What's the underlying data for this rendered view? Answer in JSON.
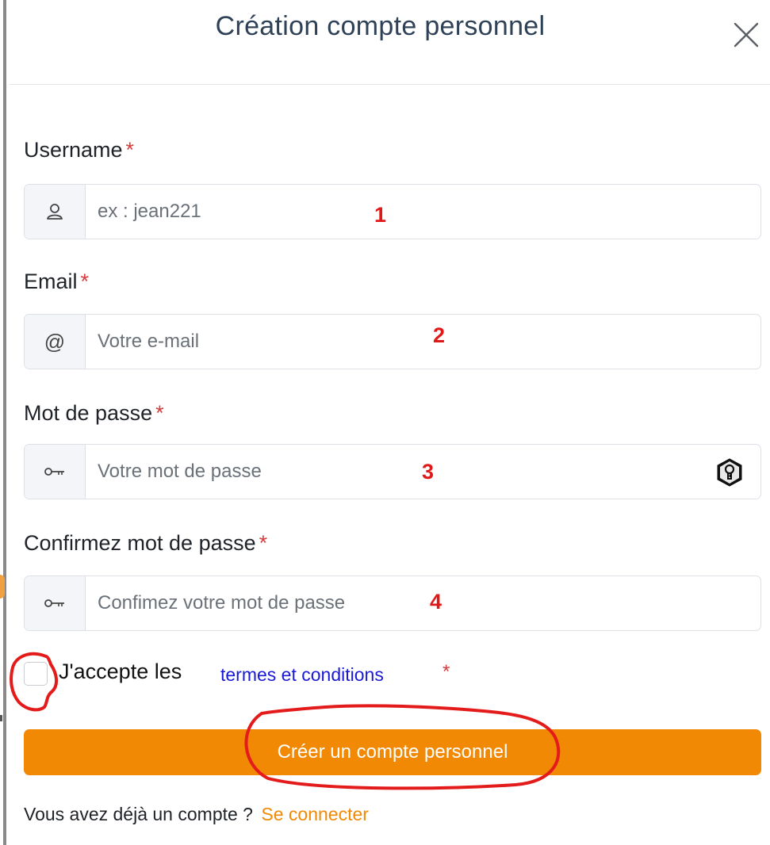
{
  "modal": {
    "title": "Création compte personnel"
  },
  "form": {
    "username": {
      "label": "Username",
      "required_mark": "*",
      "placeholder": "ex : jean221",
      "icon": "user-icon",
      "annotation": "1"
    },
    "email": {
      "label": "Email",
      "required_mark": "*",
      "placeholder": "Votre e-mail",
      "icon_text": "@",
      "annotation": "2"
    },
    "password": {
      "label": "Mot de passe",
      "required_mark": "*",
      "placeholder": "Votre mot de passe",
      "icon": "key-icon",
      "toggle_icon": "keyhole-shield-icon",
      "annotation": "3"
    },
    "confirm_password": {
      "label": "Confirmez mot de passe",
      "required_mark": "*",
      "placeholder": "Confimez votre mot de passe",
      "icon": "key-icon",
      "annotation": "4"
    },
    "terms": {
      "prefix": "J'accepte les",
      "link": "termes et conditions",
      "required_mark": "*",
      "checked": false
    },
    "submit_label": "Créer un compte personnel",
    "login_prompt": "Vous avez déjà un compte ?",
    "login_link": "Se connecter"
  },
  "colors": {
    "accent": "#f18905",
    "required": "#d63c3c",
    "link": "#1a1ad6",
    "annotation": "#e01818",
    "title": "#2f4156"
  }
}
